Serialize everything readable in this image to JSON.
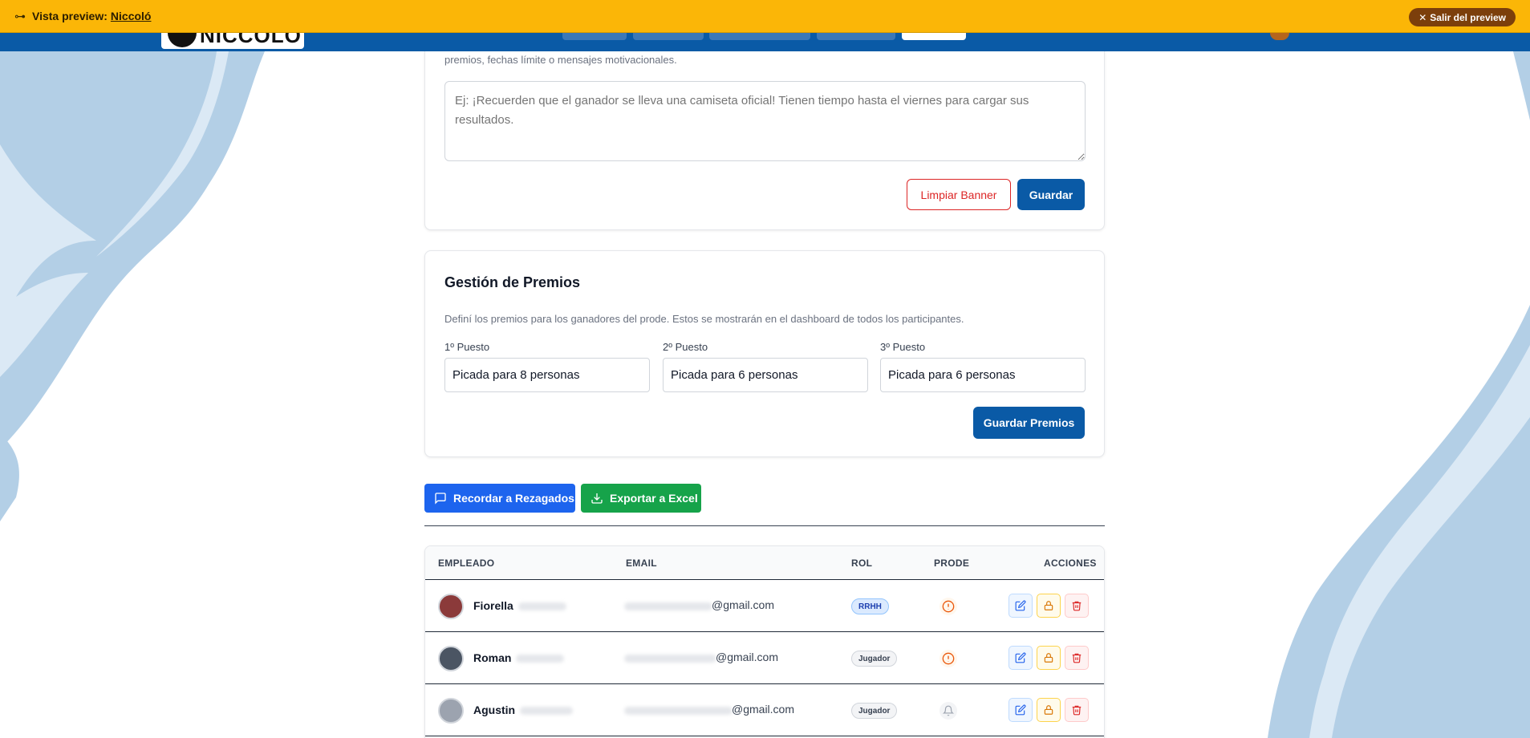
{
  "preview_bar": {
    "label": "Vista preview:",
    "name": "Niccoló",
    "exit_label": "Salir del preview"
  },
  "banner": {
    "hint": "premios, fechas límite o mensajes motivacionales.",
    "placeholder": "Ej: ¡Recuerden que el ganador se lleva una camiseta oficial! Tienen tiempo hasta el viernes para cargar sus resultados.",
    "clear_label": "Limpiar Banner",
    "save_label": "Guardar"
  },
  "prizes": {
    "title": "Gestión de Premios",
    "description": "Definí los premios para los ganadores del prode. Estos se mostrarán en el dashboard de todos los participantes.",
    "fields": [
      {
        "label": "1º Puesto",
        "value": "Picada para 8 personas"
      },
      {
        "label": "2º Puesto",
        "value": "Picada para 6 personas"
      },
      {
        "label": "3º Puesto",
        "value": "Picada para 6 personas"
      }
    ],
    "save_label": "Guardar Premios"
  },
  "actions": {
    "remind_label": "Recordar a Rezagados",
    "export_label": "Exportar a Excel"
  },
  "table": {
    "headers": {
      "employee": "EMPLEADO",
      "email": "EMAIL",
      "role": "ROL",
      "prode": "PRODE",
      "actions": "ACCIONES"
    },
    "rows": [
      {
        "name": "Fiorella",
        "email_domain": "@gmail.com",
        "role": "RRHH",
        "prode": "pending"
      },
      {
        "name": "Roman",
        "email_domain": "@gmail.com",
        "role": "Jugador",
        "prode": "pending"
      },
      {
        "name": "Agustin",
        "email_domain": "@gmail.com",
        "role": "Jugador",
        "prode": "reminder"
      }
    ]
  },
  "colors": {
    "preview_bar": "#fbb607",
    "primary": "#0a5aa6",
    "remind": "#1d64ee",
    "export": "#16a34a",
    "danger": "#dc2626"
  }
}
